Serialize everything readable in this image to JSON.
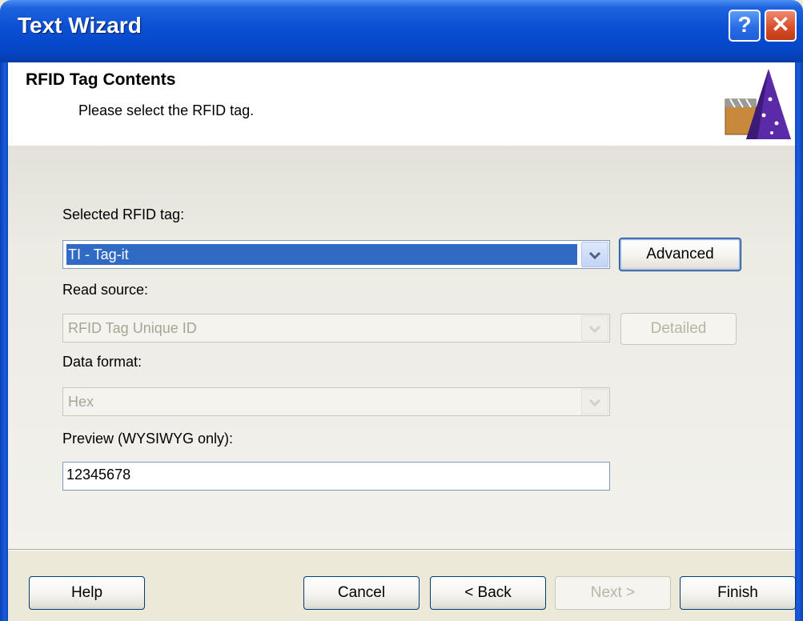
{
  "window": {
    "title": "Text Wizard",
    "help_glyph": "?",
    "close_glyph": "✕"
  },
  "header": {
    "title": "RFID Tag Contents",
    "subtitle": "Please select the RFID tag.",
    "icon": "wizard-hat-icon"
  },
  "form": {
    "rfid_tag_label": "Selected RFID tag:",
    "rfid_tag_value": "TI - Tag-it",
    "advanced_label": "Advanced",
    "read_source_label": "Read source:",
    "read_source_value": "RFID Tag Unique ID",
    "detailed_label": "Detailed",
    "data_format_label": "Data format:",
    "data_format_value": "Hex",
    "preview_label": "Preview (WYSIWYG only):",
    "preview_value": "12345678"
  },
  "footer": {
    "help": "Help",
    "cancel": "Cancel",
    "back": "< Back",
    "next": "Next >",
    "finish": "Finish"
  },
  "colors": {
    "titlebar": "#0a4fd3",
    "selection": "#316ac5",
    "dialog_bg": "#ece9d8"
  }
}
